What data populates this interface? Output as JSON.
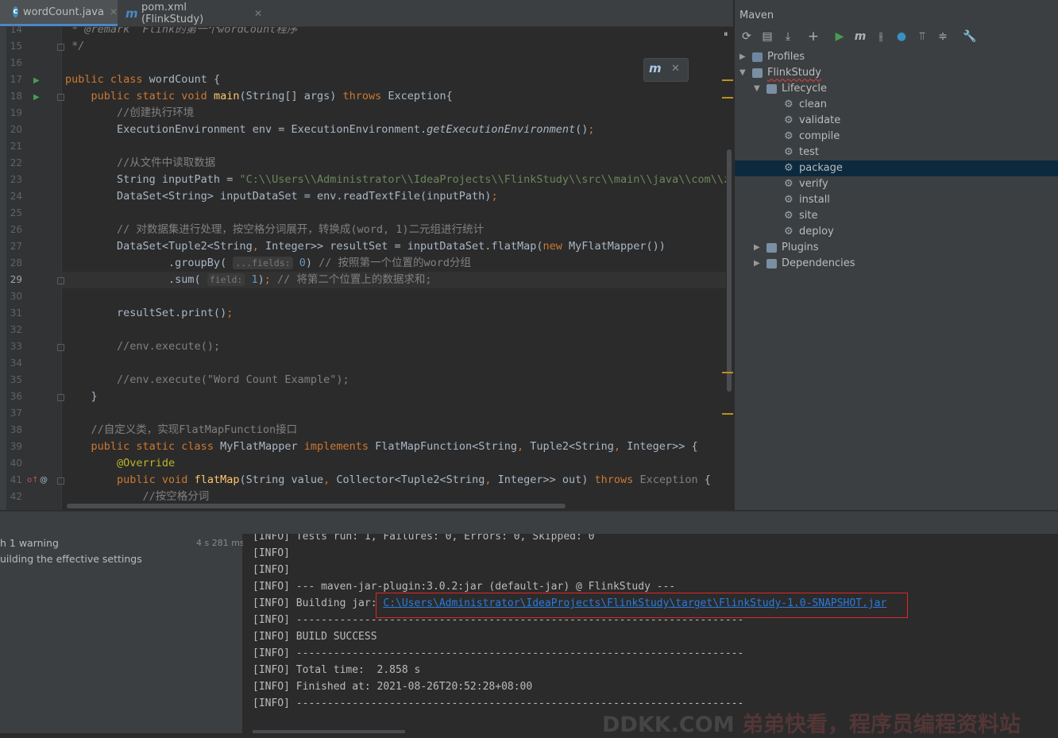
{
  "tabs": [
    {
      "label": "wordCount.java",
      "icon": "java-class-icon",
      "active": true
    },
    {
      "label": "pom.xml (FlinkStudy)",
      "icon": "maven-icon",
      "active": false
    }
  ],
  "editor": {
    "lines": [
      {
        "n": "14",
        "html": "<span class=\"cm it\"> * @remark  Flink的第一个wordCount程序</span>"
      },
      {
        "n": "15",
        "html": "<span class=\"cm it\"> */</span>"
      },
      {
        "n": "16",
        "html": ""
      },
      {
        "n": "17",
        "html": "<span class=\"kw\">public class </span>wordCount {"
      },
      {
        "n": "18",
        "html": "    <span class=\"kw\">public static void </span><span class=\"fn\">main</span>(String[] args) <span class=\"kw\">throws </span>Exception{"
      },
      {
        "n": "19",
        "html": "        <span class=\"cm\">//创建执行环境</span>"
      },
      {
        "n": "20",
        "html": "        ExecutionEnvironment env = ExecutionEnvironment.<span class=\"it\">getExecutionEnvironment</span>()<span class=\"kw\">;</span>"
      },
      {
        "n": "21",
        "html": ""
      },
      {
        "n": "22",
        "html": "        <span class=\"cm\">//从文件中读取数据</span>"
      },
      {
        "n": "23",
        "html": "        String inputPath = <span class=\"str\">\"C:\\\\Users\\\\Administrator\\\\IdeaProjects\\\\FlinkStudy\\\\src\\\\main\\\\java\\\\com\\\\zqs</span>"
      },
      {
        "n": "24",
        "html": "        DataSet&lt;String&gt; inputDataSet = env.readTextFile(inputPath)<span class=\"kw\">;</span>"
      },
      {
        "n": "25",
        "html": ""
      },
      {
        "n": "26",
        "html": "        <span class=\"cm\">// 对数据集进行处理，按空格分词展开，转换成(word, 1)二元组进行统计</span>"
      },
      {
        "n": "27",
        "html": "        DataSet&lt;Tuple2&lt;String<span class=\"kw\">, </span>Integer&gt;&gt; resultSet = inputDataSet.flatMap(<span class=\"kw\">new </span>MyFlatMapper())"
      },
      {
        "n": "28",
        "html": "                .groupBy( <span class=\"hint\">...fields:</span> <span class=\"num\">0</span>) <span class=\"cm\">// 按照第一个位置的word分组</span>"
      },
      {
        "n": "29",
        "html": "                .sum( <span class=\"hint\">field:</span> <span class=\"num\">1</span>)<span class=\"kw\">; </span><span class=\"cm\">// 将第二个位置上的数据求和;</span>"
      },
      {
        "n": "30",
        "html": ""
      },
      {
        "n": "31",
        "html": "        resultSet.print()<span class=\"kw\">;</span>"
      },
      {
        "n": "32",
        "html": ""
      },
      {
        "n": "33",
        "html": "        <span class=\"cm\">//env.execute();</span>"
      },
      {
        "n": "34",
        "html": ""
      },
      {
        "n": "35",
        "html": "        <span class=\"cm\">//env.execute(\"Word Count Example\");</span>"
      },
      {
        "n": "36",
        "html": "    }"
      },
      {
        "n": "37",
        "html": ""
      },
      {
        "n": "38",
        "html": "    <span class=\"cm\">//自定义类，实现FlatMapFunction接口</span>"
      },
      {
        "n": "39",
        "html": "    <span class=\"kw\">public static class </span>MyFlatMapper <span class=\"kw\">implements </span>FlatMapFunction&lt;String<span class=\"kw\">, </span>Tuple2&lt;String<span class=\"kw\">, </span>Integer&gt;&gt; {"
      },
      {
        "n": "40",
        "html": "        <span class=\"ann\">@Override</span>"
      },
      {
        "n": "41",
        "html": "        <span class=\"kw\">public void </span><span class=\"fn\">flatMap</span>(String value<span class=\"kw\">, </span>Collector&lt;Tuple2&lt;String<span class=\"kw\">, </span>Integer&gt;&gt; out) <span class=\"kw\">throws </span><span class=\"cm\">Exception</span> {"
      },
      {
        "n": "42",
        "html": "            <span class=\"cm\">//按空格分词</span>"
      }
    ],
    "current_line": "29"
  },
  "maven": {
    "title": "Maven",
    "toolbar": [
      "refresh-icon",
      "add-folder-icon",
      "download-icon",
      "plus-icon",
      "run-icon",
      "maven-goal-icon",
      "toggle-offline-icon",
      "skip-tests-icon",
      "show-dependencies-icon",
      "collapse-icon",
      "settings-wrench-icon"
    ],
    "tree": [
      {
        "label": "Profiles",
        "level": 0,
        "arrow": "▶",
        "icon": "profiles-icon"
      },
      {
        "label": "FlinkStudy",
        "level": 0,
        "arrow": "▼",
        "icon": "project-icon"
      },
      {
        "label": "Lifecycle",
        "level": 1,
        "arrow": "▼",
        "icon": "folder-icon"
      },
      {
        "label": "clean",
        "level": 2,
        "icon": "gear-icon"
      },
      {
        "label": "validate",
        "level": 2,
        "icon": "gear-icon"
      },
      {
        "label": "compile",
        "level": 2,
        "icon": "gear-icon"
      },
      {
        "label": "test",
        "level": 2,
        "icon": "gear-icon"
      },
      {
        "label": "package",
        "level": 2,
        "icon": "gear-icon",
        "selected": true
      },
      {
        "label": "verify",
        "level": 2,
        "icon": "gear-icon"
      },
      {
        "label": "install",
        "level": 2,
        "icon": "gear-icon"
      },
      {
        "label": "site",
        "level": 2,
        "icon": "gear-icon"
      },
      {
        "label": "deploy",
        "level": 2,
        "icon": "gear-icon"
      },
      {
        "label": "Plugins",
        "level": 1,
        "arrow": "▶",
        "icon": "folder-icon"
      },
      {
        "label": "Dependencies",
        "level": 1,
        "arrow": "▶",
        "icon": "dependencies-icon"
      }
    ]
  },
  "build": {
    "row1_label": "h 1 warning",
    "row1_time": "4 s 281 ms",
    "row2_label": "uilding the effective settings"
  },
  "console": {
    "lines": [
      "[INFO] Tests run: 1, Failures: 0, Errors: 0, Skipped: 0",
      "[INFO]",
      "[INFO]",
      "[INFO] --- maven-jar-plugin:3.0.2:jar (default-jar) @ FlinkStudy ---",
      "[INFO] Building jar: ",
      "[INFO] ------------------------------------------------------------------------",
      "[INFO] BUILD SUCCESS",
      "[INFO] ------------------------------------------------------------------------",
      "[INFO] Total time:  2.858 s",
      "[INFO] Finished at: 2021-08-26T20:52:28+08:00",
      "[INFO] ------------------------------------------------------------------------"
    ],
    "jar_link": "C:\\Users\\Administrator\\IdeaProjects\\FlinkStudy\\target\\FlinkStudy-1.0-SNAPSHOT.jar"
  },
  "watermark": {
    "part1": "DDKK.COM ",
    "part2": "弟弟快看，程序员编程资料站"
  }
}
